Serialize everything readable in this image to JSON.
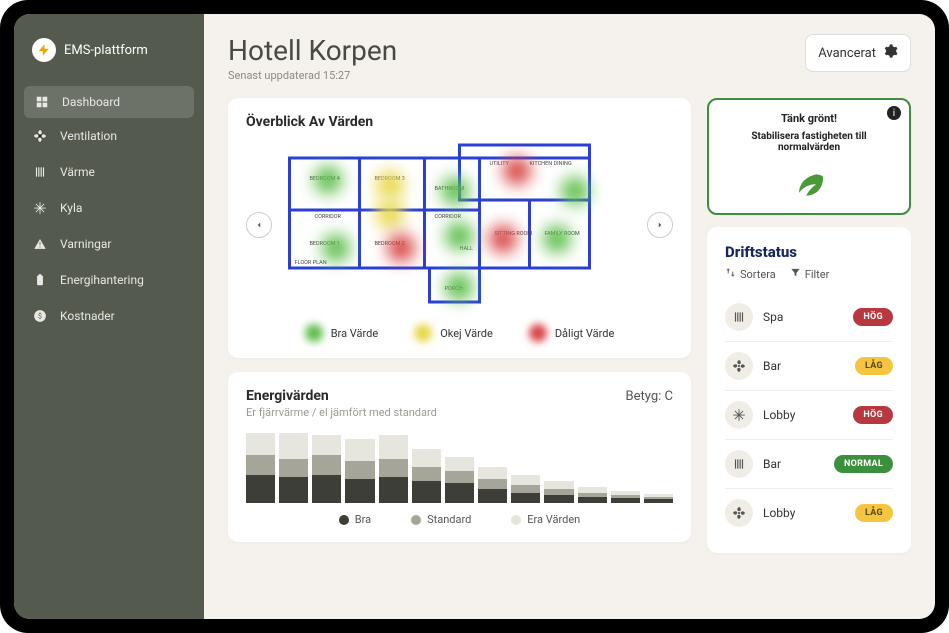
{
  "brand": "EMS-plattform",
  "sidebar": {
    "items": [
      {
        "label": "Dashboard",
        "icon": "grid"
      },
      {
        "label": "Ventilation",
        "icon": "fan"
      },
      {
        "label": "Värme",
        "icon": "heat"
      },
      {
        "label": "Kyla",
        "icon": "snow"
      },
      {
        "label": "Varningar",
        "icon": "warning"
      },
      {
        "label": "Energihantering",
        "icon": "battery"
      },
      {
        "label": "Kostnader",
        "icon": "money"
      }
    ]
  },
  "header": {
    "title": "Hotell Korpen",
    "subtitle": "Senast uppdaterad 15:27",
    "advanced_label": "Avancerat"
  },
  "overview": {
    "title": "Överblick Av Värden",
    "legend": {
      "good": "Bra Värde",
      "ok": "Okej Värde",
      "bad": "Dåligt Värde"
    },
    "colors": {
      "good": "#5fbf4d",
      "ok": "#e8d84a",
      "bad": "#d94444"
    },
    "rooms": [
      "BEDROOM 4",
      "BEDROOM 3",
      "BATHROOM",
      "UTILITY",
      "KITCHEN DINING",
      "CORRIDOR",
      "CORRIDOR",
      "HALL",
      "SITTING ROOM",
      "FAMILY ROOM",
      "BEDROOM 1",
      "BEDROOM 2",
      "PORCH",
      "FLOOR PLAN"
    ]
  },
  "energy": {
    "title": "Energivärden",
    "subtitle": "Er fjärrvärme / el jämfört med standard",
    "grade_label": "Betyg: C",
    "legend": {
      "good": "Bra",
      "standard": "Standard",
      "yours": "Era Värden"
    }
  },
  "tip": {
    "title": "Tänk grönt!",
    "subtitle": "Stabilisera fastigheten till normalvärden"
  },
  "status": {
    "title": "Driftstatus",
    "sort_label": "Sortera",
    "filter_label": "Filter",
    "items": [
      {
        "name": "Spa",
        "icon": "heat",
        "level": "HÖG",
        "color": "red"
      },
      {
        "name": "Bar",
        "icon": "fan",
        "level": "LÅG",
        "color": "yellow"
      },
      {
        "name": "Lobby",
        "icon": "snow",
        "level": "HÖG",
        "color": "red"
      },
      {
        "name": "Bar",
        "icon": "heat",
        "level": "NORMAL",
        "color": "green"
      },
      {
        "name": "Lobby",
        "icon": "fan",
        "level": "LÅG",
        "color": "yellow"
      }
    ]
  },
  "chart_data": {
    "type": "bar",
    "title": "Energivärden",
    "xlabel": "",
    "ylabel": "",
    "series_names": [
      "Bra",
      "Standard",
      "Era Värden"
    ],
    "bars": [
      {
        "a": 28,
        "b": 20,
        "c": 22
      },
      {
        "a": 26,
        "b": 18,
        "c": 26
      },
      {
        "a": 28,
        "b": 20,
        "c": 20
      },
      {
        "a": 24,
        "b": 18,
        "c": 22
      },
      {
        "a": 26,
        "b": 18,
        "c": 24
      },
      {
        "a": 22,
        "b": 14,
        "c": 18
      },
      {
        "a": 20,
        "b": 12,
        "c": 14
      },
      {
        "a": 14,
        "b": 10,
        "c": 12
      },
      {
        "a": 10,
        "b": 8,
        "c": 10
      },
      {
        "a": 8,
        "b": 6,
        "c": 8
      },
      {
        "a": 6,
        "b": 4,
        "c": 6
      },
      {
        "a": 5,
        "b": 3,
        "c": 4
      },
      {
        "a": 4,
        "b": 2,
        "c": 3
      }
    ],
    "ylim": [
      0,
      70
    ]
  }
}
